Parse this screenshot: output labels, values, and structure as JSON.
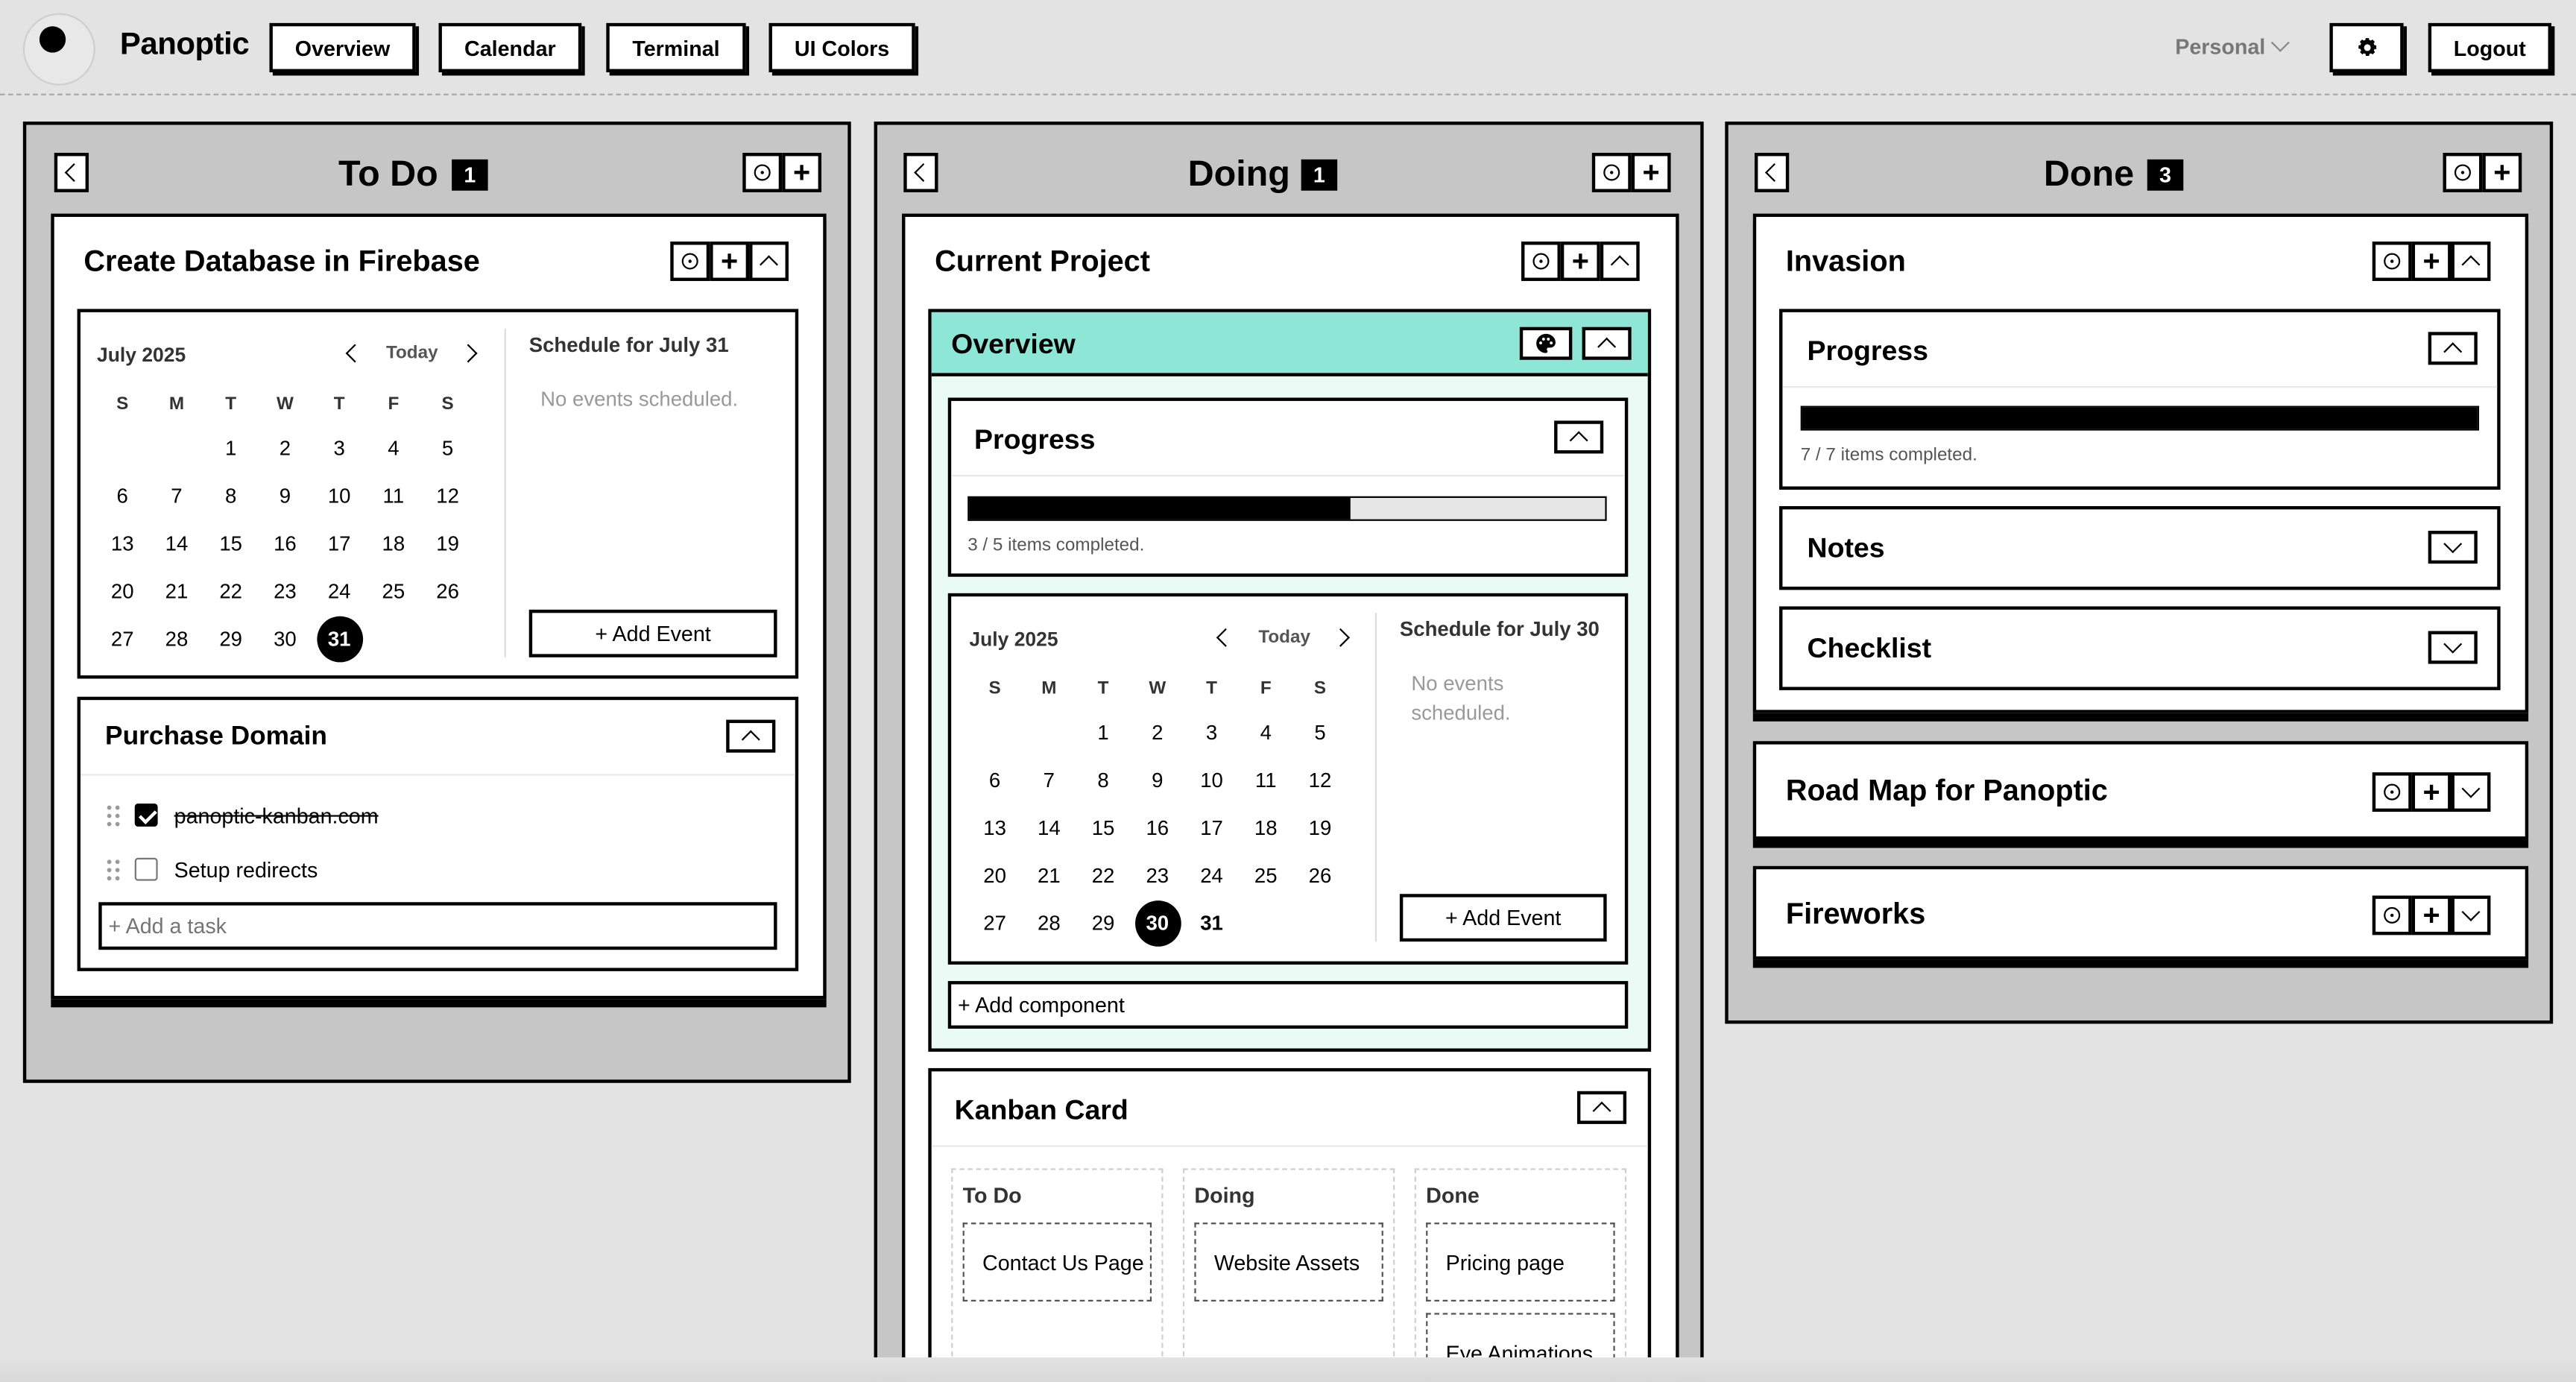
{
  "app": {
    "brand": "Panoptic",
    "nav": [
      "Overview",
      "Calendar",
      "Terminal",
      "UI Colors"
    ],
    "workspace": "Personal",
    "logout": "Logout"
  },
  "columns": {
    "todo": {
      "title": "To Do",
      "count": "1",
      "card1": {
        "title": "Create Database in Firebase",
        "calendar": {
          "month": "July 2025",
          "today_label": "Today",
          "dow": [
            "S",
            "M",
            "T",
            "W",
            "T",
            "F",
            "S"
          ],
          "weeks": [
            [
              "",
              "",
              "1",
              "2",
              "3",
              "4",
              "5"
            ],
            [
              "6",
              "7",
              "8",
              "9",
              "10",
              "11",
              "12"
            ],
            [
              "13",
              "14",
              "15",
              "16",
              "17",
              "18",
              "19"
            ],
            [
              "20",
              "21",
              "22",
              "23",
              "24",
              "25",
              "26"
            ],
            [
              "27",
              "28",
              "29",
              "30",
              "31",
              "",
              ""
            ]
          ],
          "selected": "31",
          "schedule_title": "Schedule for July 31",
          "empty": "No events scheduled.",
          "add_event": "+ Add Event"
        },
        "purchase": {
          "title": "Purchase Domain",
          "tasks": [
            {
              "text": "panoptic-kanban.com",
              "done": true
            },
            {
              "text": "Setup redirects",
              "done": false
            }
          ],
          "add_task_placeholder": "+ Add a task"
        }
      }
    },
    "doing": {
      "title": "Doing",
      "count": "1",
      "card1": {
        "title": "Current Project",
        "overview": {
          "title": "Overview",
          "progress": {
            "title": "Progress",
            "completed": 3,
            "total": 5,
            "text": "3 / 5 items completed."
          },
          "calendar": {
            "month": "July 2025",
            "today_label": "Today",
            "dow": [
              "S",
              "M",
              "T",
              "W",
              "T",
              "F",
              "S"
            ],
            "weeks": [
              [
                "",
                "",
                "1",
                "2",
                "3",
                "4",
                "5"
              ],
              [
                "6",
                "7",
                "8",
                "9",
                "10",
                "11",
                "12"
              ],
              [
                "13",
                "14",
                "15",
                "16",
                "17",
                "18",
                "19"
              ],
              [
                "20",
                "21",
                "22",
                "23",
                "24",
                "25",
                "26"
              ],
              [
                "27",
                "28",
                "29",
                "30",
                "31",
                "",
                ""
              ]
            ],
            "selected": "30",
            "bold_day": "31",
            "schedule_title": "Schedule for July 30",
            "empty_line1": "No events",
            "empty_line2": "scheduled.",
            "add_event": "+ Add Event"
          },
          "add_component": "+ Add component"
        },
        "kanban": {
          "title": "Kanban Card",
          "cols": [
            {
              "name": "To Do",
              "cards": [
                "Contact Us Page"
              ]
            },
            {
              "name": "Doing",
              "cards": [
                "Website Assets"
              ]
            },
            {
              "name": "Done",
              "cards": [
                "Pricing page",
                "Eye Animations"
              ]
            }
          ]
        }
      }
    },
    "done": {
      "title": "Done",
      "count": "3",
      "card1": {
        "title": "Invasion",
        "progress": {
          "title": "Progress",
          "completed": 7,
          "total": 7,
          "text": "7 / 7 items completed."
        },
        "notes": "Notes",
        "checklist": "Checklist"
      },
      "card2": {
        "title": "Road Map for Panoptic"
      },
      "card3": {
        "title": "Fireworks"
      }
    }
  },
  "colors": {
    "overview_header": "#8ee6d6",
    "overview_body": "#eafaf4",
    "column_bg": "#c6c6c6"
  }
}
